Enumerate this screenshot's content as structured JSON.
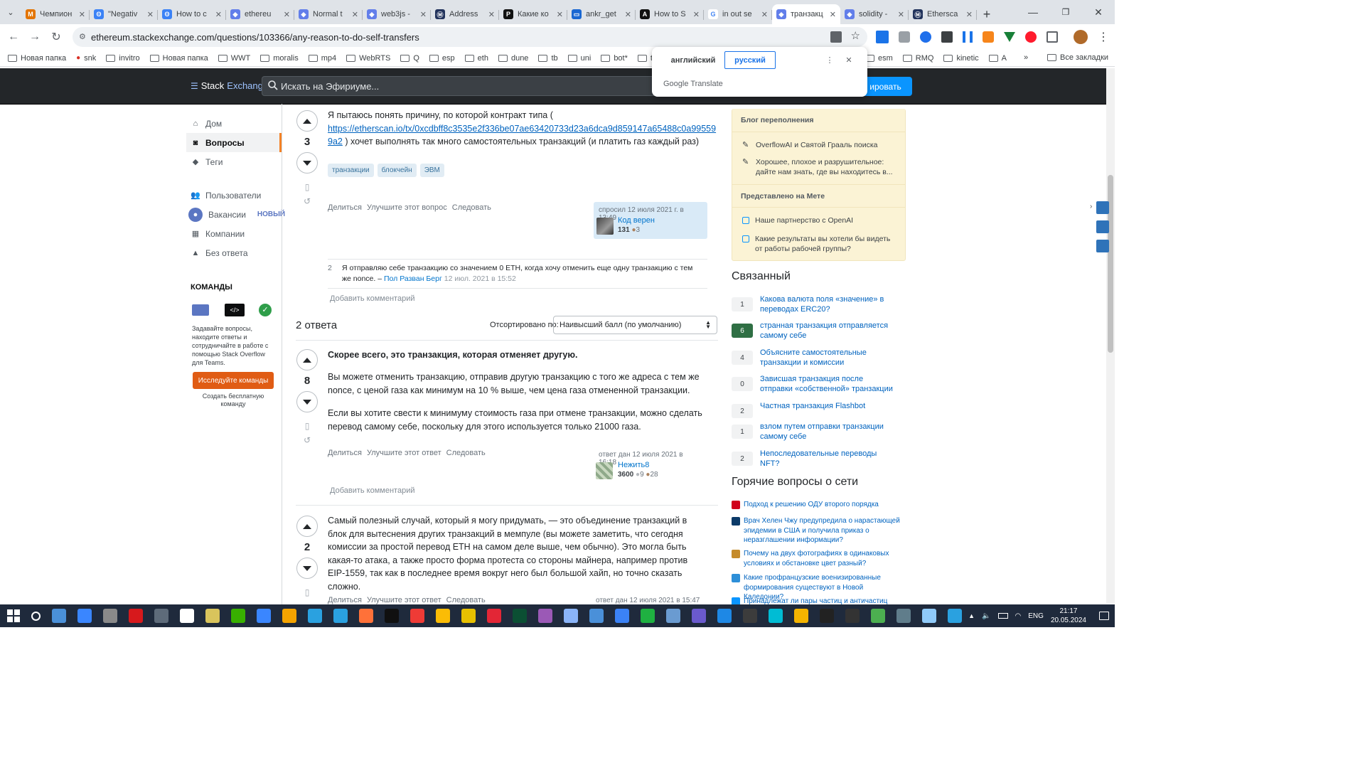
{
  "browser": {
    "tabs": [
      {
        "title": "Чемпион",
        "color": "#e37400",
        "glyph": "M"
      },
      {
        "title": "\"Negativ",
        "color": "#3b82f6",
        "glyph": "ʘ"
      },
      {
        "title": "How to c",
        "color": "#3b82f6",
        "glyph": "ʘ"
      },
      {
        "title": "ethereu",
        "color": "#627eea",
        "glyph": "◆"
      },
      {
        "title": "Normal t",
        "color": "#627eea",
        "glyph": "◆"
      },
      {
        "title": "web3js -",
        "color": "#627eea",
        "glyph": "◆"
      },
      {
        "title": "Address",
        "color": "#21325b",
        "glyph": "Ⓜ"
      },
      {
        "title": "Какие ко",
        "color": "#111111",
        "glyph": "P"
      },
      {
        "title": "ankr_get",
        "color": "#1967d2",
        "glyph": "▭"
      },
      {
        "title": "How to S",
        "color": "#111111",
        "glyph": "A"
      },
      {
        "title": "in out se",
        "color": "#ffffff",
        "glyph": "G"
      },
      {
        "title": "транзакц",
        "color": "#627eea",
        "glyph": "◆"
      },
      {
        "title": "solidity -",
        "color": "#627eea",
        "glyph": "◆"
      },
      {
        "title": "Ethersca",
        "color": "#21325b",
        "glyph": "Ⓜ"
      }
    ],
    "active_tab": 11,
    "url": "ethereum.stackexchange.com/questions/103366/any-reason-to-do-self-transfers",
    "bookmarks": [
      {
        "label": "Новая папка",
        "type": "folder"
      },
      {
        "label": "snk",
        "type": "pin"
      },
      {
        "label": "invitro",
        "type": "folder"
      },
      {
        "label": "Новая папка",
        "type": "folder"
      },
      {
        "label": "WWT",
        "type": "folder"
      },
      {
        "label": "moralis",
        "type": "folder"
      },
      {
        "label": "mp4",
        "type": "folder"
      },
      {
        "label": "WebRTS",
        "type": "folder"
      },
      {
        "label": "Q",
        "type": "folder"
      },
      {
        "label": "esp",
        "type": "folder"
      },
      {
        "label": "eth",
        "type": "folder"
      },
      {
        "label": "dune",
        "type": "folder"
      },
      {
        "label": "tb",
        "type": "folder"
      },
      {
        "label": "uni",
        "type": "folder"
      },
      {
        "label": "bot*",
        "type": "folder"
      },
      {
        "label": "t",
        "type": "folder"
      }
    ],
    "bookmarks_right": [
      {
        "label": "esm",
        "type": "folder"
      },
      {
        "label": "RMQ",
        "type": "folder"
      },
      {
        "label": "kinetic",
        "type": "folder"
      },
      {
        "label": "A",
        "type": "folder"
      }
    ],
    "all_bookmarks": "Все закладки",
    "translate": {
      "from": "английский",
      "to": "русский",
      "brand": "Google Translate"
    }
  },
  "header": {
    "logo_stack": "Stack",
    "logo_exchange": "Exchange",
    "search_placeholder": "Искать на Эфириуме...",
    "signup": "ировать"
  },
  "leftnav": {
    "items": [
      {
        "label": "Дом",
        "icon": "home-icon",
        "glyph": "⌂"
      },
      {
        "label": "Вопросы",
        "icon": "question-icon",
        "glyph": "◙"
      },
      {
        "label": "Теги",
        "icon": "tag-icon",
        "glyph": "◆"
      },
      {
        "label": "Пользователи",
        "icon": "users-icon",
        "glyph": "👥"
      },
      {
        "label": "Вакансии",
        "icon": "jobs-icon",
        "glyph": "●"
      },
      {
        "label": "Компании",
        "icon": "companies-icon",
        "glyph": "▦"
      },
      {
        "label": "Без ответа",
        "icon": "unanswered-icon",
        "glyph": "▲"
      }
    ],
    "new_badge": "НОВЫЙ",
    "teams_title": "КОМАНДЫ",
    "teams_text": "Задавайте вопросы, находите ответы и сотрудничайте в работе с помощью Stack Overflow для Teams.",
    "teams_button": "Исследуйте команды",
    "teams_free": "Создать бесплатную команду"
  },
  "question": {
    "score": "3",
    "text_before": "Я пытаюсь понять причину, по которой контракт типа (",
    "link": "https://etherscan.io/tx/0xcdbff8c3535e2f336be07ae63420733d23a6dca9d859147a65488c0a995599a2",
    "link_line1": "https://etherscan.io/tx/0xcdbff8c3535e2f336be07ae63420733d23a6dca9d859147a65488c0a99559",
    "link_line2": "9a2",
    "text_after": ") хочет выполнять так много самостоятельных транзакций (и платить газ каждый раз)",
    "tags": [
      "транзакции",
      "блокчейн",
      "ЭВМ"
    ],
    "menu": [
      "Делиться",
      "Улучшите этот вопрос",
      "Следовать"
    ],
    "asked": "спросил 12 июля 2021 г. в 13:49",
    "user": "Код верен",
    "rep": "131",
    "bronze": "3",
    "comment_score": "2",
    "comment_text": "Я отправляю себе транзакцию со значением 0 ETH, когда хочу отменить еще одну транзакцию с тем же nonce. –",
    "comment_user": "Пол Разван Берг",
    "comment_date": "12 июл. 2021 в 15:52",
    "add_comment": "Добавить комментарий"
  },
  "answers_header": {
    "count": "2 ответа",
    "sort_label": "Отсортировано по:",
    "sort_value": "Наивысший балл (по умолчанию)"
  },
  "answer1": {
    "score": "8",
    "title": "Скорее всего, это транзакция, которая отменяет другую.",
    "p1": "Вы можете отменить транзакцию, отправив другую транзакцию с того же адреса с тем же nonce, с ценой газа как минимум на 10 % выше, чем цена газа отмененной транзакции.",
    "p2": "Если вы хотите свести к минимуму стоимость газа при отмене транзакции, можно сделать перевод самому себе, поскольку для этого используется только 21000 газа.",
    "menu": [
      "Делиться",
      "Улучшите этот ответ",
      "Следовать"
    ],
    "answered": "ответ дан 12 июля 2021 в 16:18",
    "user": "Нежить8",
    "rep": "3600",
    "silver": "9",
    "bronze": "28",
    "add_comment": "Добавить комментарий"
  },
  "answer2": {
    "score": "2",
    "text": "Самый полезный случай, который я могу придумать, — это объединение транзакций в блок для вытеснения других транзакций в мемпуле (вы можете заметить, что сегодня комиссии за простой перевод ETH на самом деле выше, чем обычно). Это могла быть какая-то атака, а также просто форма протеста со стороны майнера, например против EIP-1559, так как в последнее время вокруг него был большой хайп, но точно сказать сложно.",
    "menu": [
      "Делиться",
      "Улучшите этот ответ",
      "Следовать"
    ],
    "answered": "ответ дан 12 июля 2021 в 15:47"
  },
  "sidebar": {
    "blog_title": "Блог переполнения",
    "blog_items": [
      "OverflowAI и Святой Грааль поиска",
      "Хорошее, плохое и разрушительное: дайте нам знать, где вы находитесь в..."
    ],
    "meta_title": "Представлено на Мете",
    "meta_items": [
      "Наше партнерство с OpenAI",
      "Какие результаты вы хотели бы видеть от работы рабочей группы?"
    ],
    "related_title": "Связанный",
    "related": [
      {
        "score": "1",
        "text": "Какова валюта поля «значение» в переводах ERC20?",
        "accepted": false
      },
      {
        "score": "6",
        "text": "странная транзакция отправляется самому себе",
        "accepted": true
      },
      {
        "score": "4",
        "text": "Объясните самостоятельные транзакции и комиссии",
        "accepted": false
      },
      {
        "score": "0",
        "text": "Зависшая транзакция после отправки «собственной» транзакции",
        "accepted": false
      },
      {
        "score": "2",
        "text": "Частная транзакция Flashbot",
        "accepted": false
      },
      {
        "score": "1",
        "text": "взлом путем отправки транзакции самому себе",
        "accepted": false
      },
      {
        "score": "2",
        "text": "Непоследовательные переводы NFT?",
        "accepted": false
      }
    ],
    "hot_title": "Горячие вопросы о сети",
    "hot": [
      {
        "text": "Подход к решению ОДУ второго порядка",
        "color": "#d0001b"
      },
      {
        "text": "Врач Хелен Чжу предупредила о нарастающей эпидемии в США и получила приказ о неразглашении информации?",
        "color": "#0b3a68"
      },
      {
        "text": "Почему на двух фотографиях в одинаковых условиях и обстановке цвет разный?",
        "color": "#c58b2b"
      },
      {
        "text": "Какие профранцузские военизированные формирования существуют в Новой Каледонии?",
        "color": "#2d8fd8"
      },
      {
        "text": "Принадлежат ли пары частиц и античастиц",
        "color": "#0a95ff"
      }
    ]
  },
  "taskbar": {
    "lang": "ENG",
    "time": "21:17",
    "date": "20.05.2024"
  }
}
